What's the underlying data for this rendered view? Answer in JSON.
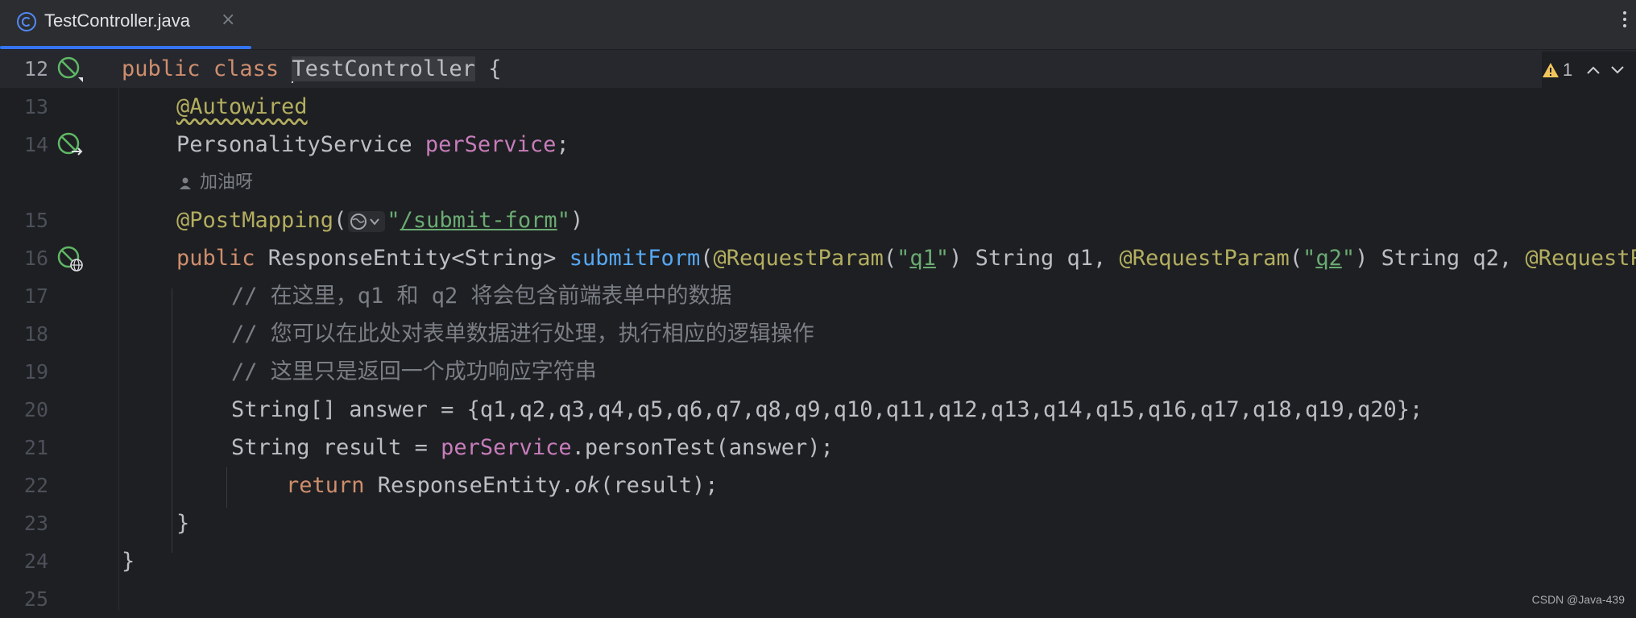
{
  "tab": {
    "title": "TestController.java",
    "close": "×"
  },
  "problems": {
    "warning_count": "1"
  },
  "hint": {
    "author": "加油呀"
  },
  "lines": [
    {
      "num": "12",
      "kw1": "public",
      "kw2": "class",
      "sel": "TestController",
      "tail": " {"
    },
    {
      "num": "13",
      "annotation": "@Autowired"
    },
    {
      "num": "14",
      "type": "PersonalityService",
      "field": "perService",
      "tail": ";"
    },
    {
      "num": "15",
      "annotation": "@PostMapping",
      "open": "(",
      "q1": "\"",
      "path": "/submit-form",
      "q2": "\"",
      "close": ")"
    },
    {
      "num": "16",
      "kw": "public",
      "type": " ResponseEntity<String> ",
      "fn": "submitForm",
      "p1": "(",
      "ann1": "@RequestParam",
      "o1": "(",
      "s1a": "\"",
      "s1": "q1",
      "s1b": "\"",
      "r1": ") String q1, ",
      "ann2": "@RequestParam",
      "o2": "(",
      "s2a": "\"",
      "s2": "q2",
      "s2b": "\"",
      "r2": ") String q2, ",
      "ann3": "@RequestParam"
    },
    {
      "num": "17",
      "comment": "// 在这里，q1 和 q2 将会包含前端表单中的数据"
    },
    {
      "num": "18",
      "comment": "// 您可以在此处对表单数据进行处理，执行相应的逻辑操作"
    },
    {
      "num": "19",
      "comment": "// 这里只是返回一个成功响应字符串"
    },
    {
      "num": "20",
      "text": "String[] answer = {q1,q2,q3,q4,q5,q6,q7,q8,q9,q10,q11,q12,q13,q14,q15,q16,q17,q18,q19,q20};"
    },
    {
      "num": "21",
      "pre": "String result = ",
      "field": "perService",
      "post": ".personTest(answer);"
    },
    {
      "num": "22",
      "kw": "return",
      "pre": " ResponseEntity.",
      "it": "ok",
      "post": "(result);"
    },
    {
      "num": "23",
      "text": "}"
    },
    {
      "num": "24",
      "text": "}"
    },
    {
      "num": "25",
      "text": ""
    }
  ],
  "watermark": "CSDN @Java-439",
  "colors": {
    "keyword": "#cf8e6d",
    "annotation": "#b3ae60",
    "field": "#c77dbb",
    "function": "#56a8f5",
    "string": "#6aab73",
    "comment": "#7a7e85",
    "accent": "#3574f0"
  }
}
